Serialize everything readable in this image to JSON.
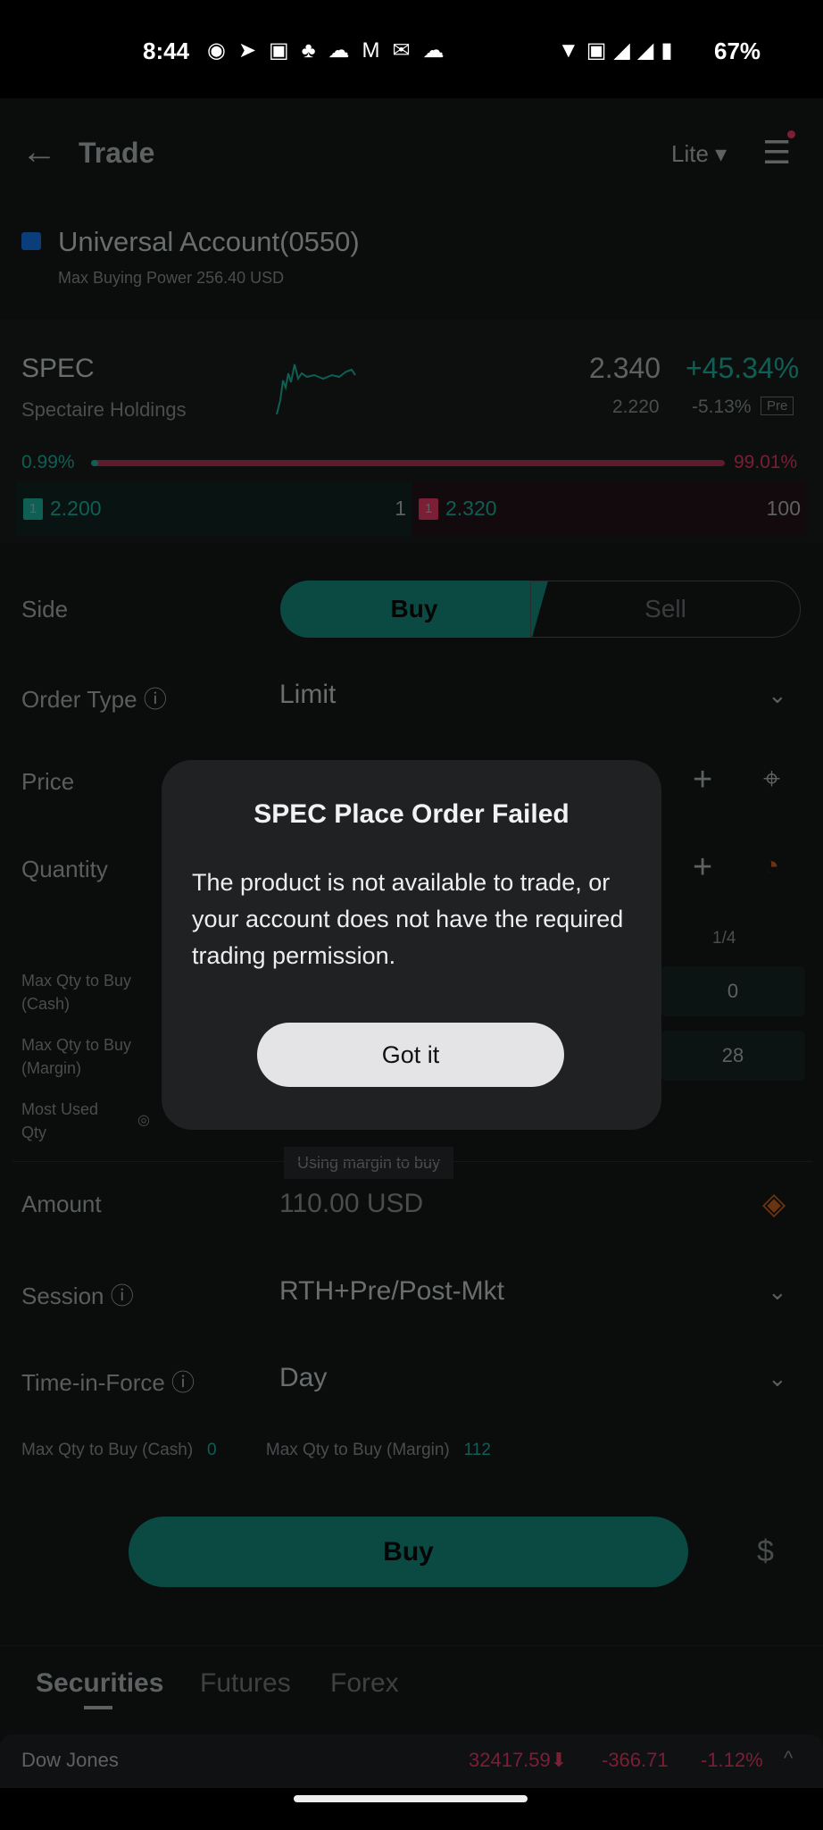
{
  "status_bar": {
    "time": "8:44",
    "battery": "67%",
    "icons": [
      "whatsapp-icon",
      "telegram-icon",
      "contacts-icon",
      "app-icon",
      "app-icon",
      "gmail-icon",
      "outlook-icon",
      "cloud-icon",
      "wifi-icon",
      "volte-icon",
      "signal-icon",
      "signal-icon",
      "battery-icon"
    ]
  },
  "header": {
    "title": "Trade",
    "mode": "Lite"
  },
  "account": {
    "name": "Universal Account(0550)",
    "buying_power": "Max Buying Power 256.40 USD"
  },
  "quote": {
    "symbol": "SPEC",
    "name": "Spectaire Holdings",
    "price": "2.340",
    "change_pct": "+45.34%",
    "pre_price": "2.220",
    "pre_change": "-5.13%",
    "pre_badge": "Pre",
    "bid_pct": "0.99%",
    "ask_pct": "99.01%",
    "bid_fraction": 0.0099,
    "bid_level": "1",
    "bid_price": "2.200",
    "bid_size": "1",
    "ask_level": "1",
    "ask_price": "2.320",
    "ask_size": "100"
  },
  "form": {
    "side_label": "Side",
    "buy": "Buy",
    "sell": "Sell",
    "order_type_label": "Order Type",
    "order_type": "Limit",
    "price_label": "Price",
    "quantity_label": "Quantity",
    "fraction": "1/4",
    "max_cash_label": "Max Qty to Buy (Cash)",
    "max_cash": "0",
    "max_margin_label": "Max Qty to Buy (Margin)",
    "max_margin": "28",
    "most_used_label": "Most Used Qty",
    "tooltip": "Using margin to buy",
    "amount_label": "Amount",
    "amount": "110.00 USD",
    "session_label": "Session",
    "session": "RTH+Pre/Post-Mkt",
    "tif_label": "Time-in-Force",
    "tif": "Day",
    "summary_cash_label": "Max Qty to Buy (Cash)",
    "summary_cash": "0",
    "summary_margin_label": "Max Qty to Buy (Margin)",
    "summary_margin": "112",
    "submit": "Buy"
  },
  "tabs": [
    "Securities",
    "Futures",
    "Forex"
  ],
  "ticker": {
    "name": "Dow Jones",
    "value": "32417.59",
    "change": "-366.71",
    "change_pct": "-1.12%"
  },
  "dialog": {
    "title": "SPEC Place Order Failed",
    "message": "The product is not available to trade, or your account does not have the required trading permission.",
    "button": "Got it"
  },
  "colors": {
    "accent": "#0a4a42",
    "down": "#7a1f36",
    "dialog_bg": "#202122"
  }
}
